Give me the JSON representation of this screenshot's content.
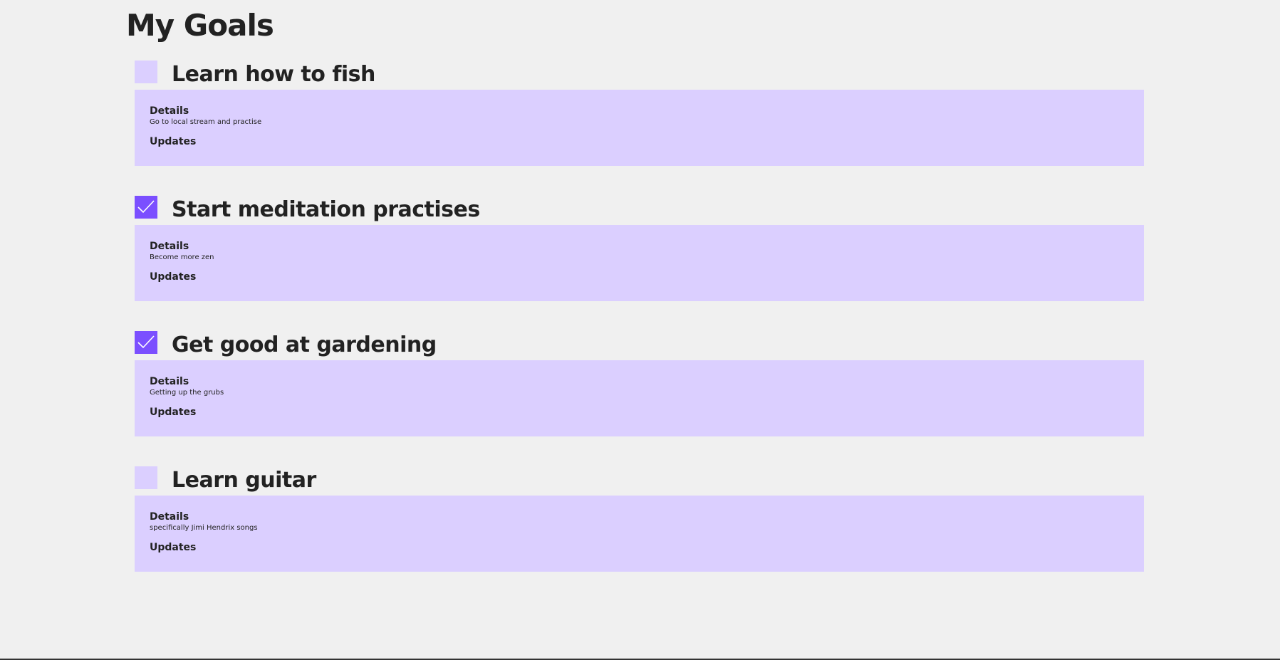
{
  "page": {
    "title": "My Goals"
  },
  "colors": {
    "background": "#f0f0f0",
    "card": "#dbcfff",
    "accent": "#7b4fff",
    "text": "#222222"
  },
  "goals": [
    {
      "title": "Learn how to fish",
      "completed": false,
      "details_label": "Details",
      "details_text": "Go to local stream and practise",
      "updates_label": "Updates"
    },
    {
      "title": "Start meditation practises",
      "completed": true,
      "details_label": "Details",
      "details_text": "Become more zen",
      "updates_label": "Updates"
    },
    {
      "title": "Get good at gardening",
      "completed": true,
      "details_label": "Details",
      "details_text": "Getting up the grubs",
      "updates_label": "Updates"
    },
    {
      "title": "Learn guitar",
      "completed": false,
      "details_label": "Details",
      "details_text": "specifically Jimi Hendrix songs",
      "updates_label": "Updates"
    }
  ]
}
